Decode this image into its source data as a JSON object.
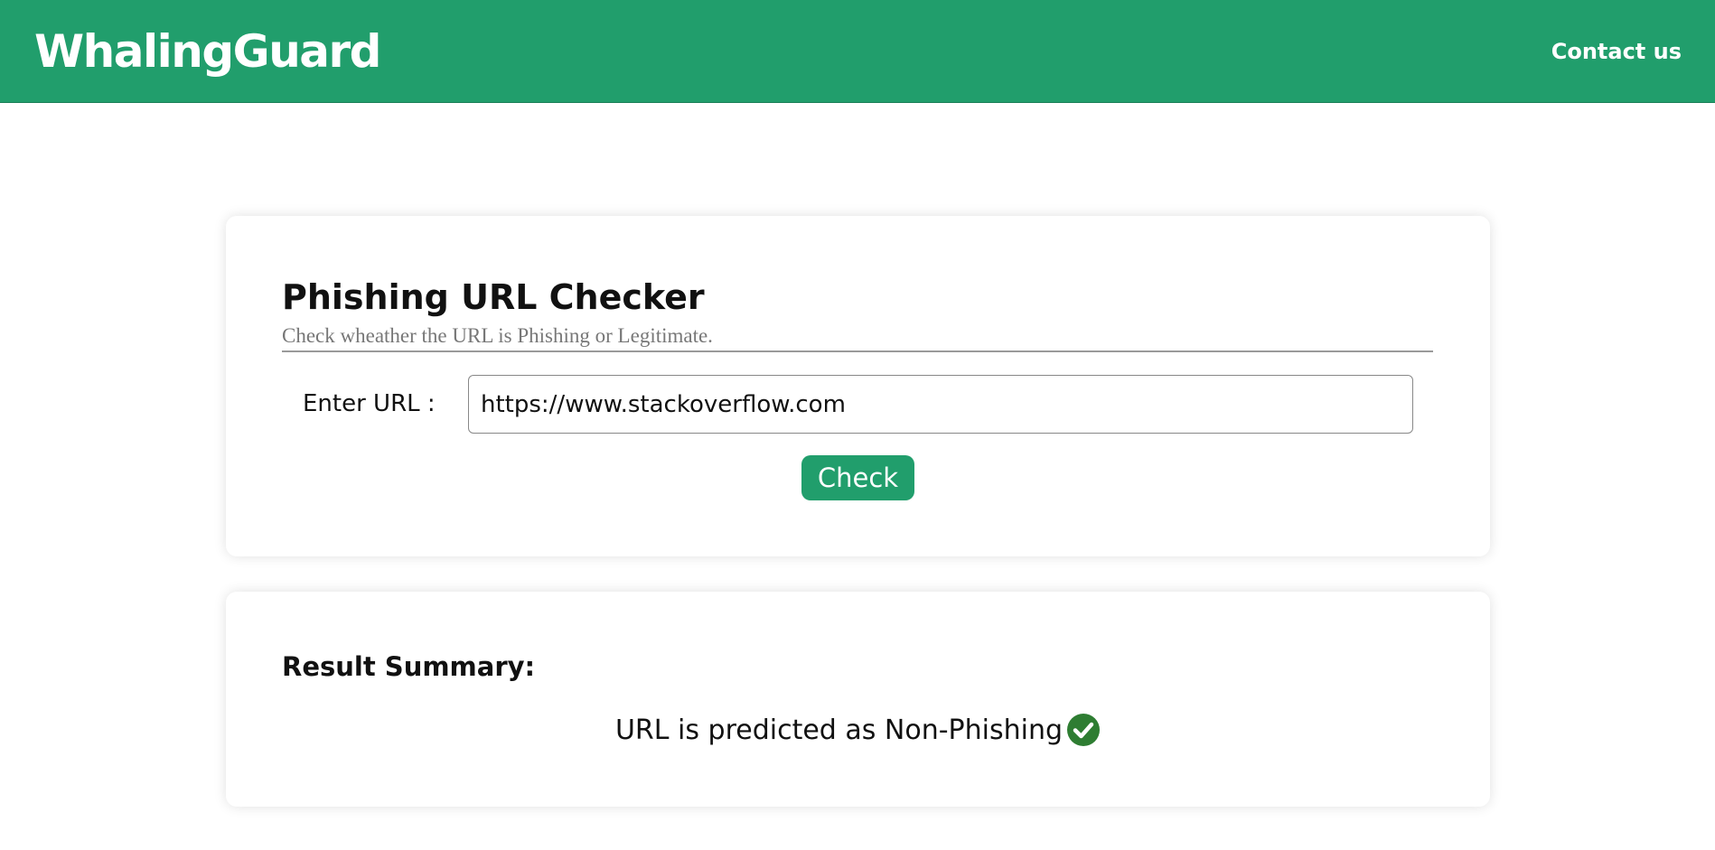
{
  "header": {
    "brand": "WhalingGuard",
    "contact_link": "Contact us",
    "background_color": "#219e6c"
  },
  "checker": {
    "title": "Phishing URL Checker",
    "subtitle": "Check wheather the URL is Phishing or Legitimate.",
    "url_label": "Enter URL :",
    "url_value": "https://www.stackoverflow.com",
    "check_button": "Check"
  },
  "result": {
    "heading": "Result Summary:",
    "prediction_text": "URL is predicted as Non-Phishing",
    "status_icon": "check-circle-icon",
    "status_color": "#2e7d32"
  }
}
